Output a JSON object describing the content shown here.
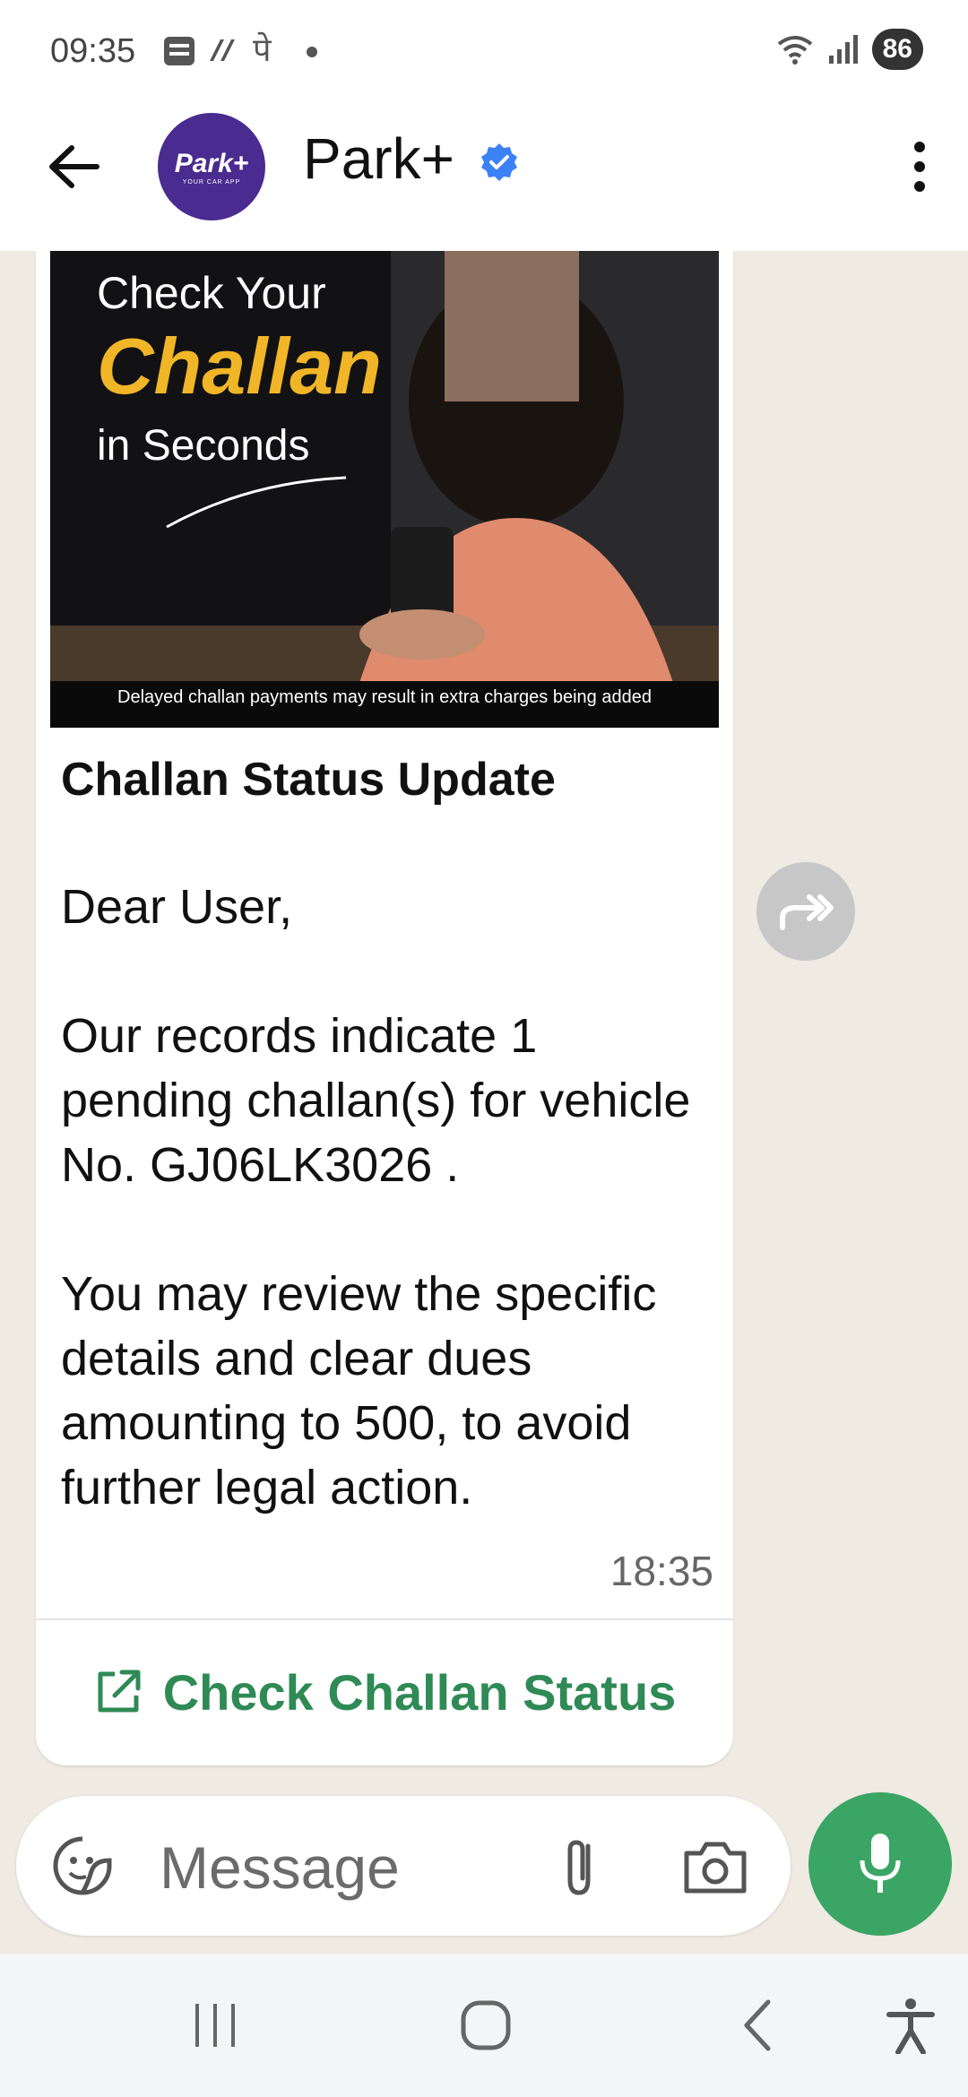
{
  "status_bar": {
    "time": "09:35",
    "battery": "86",
    "notifications": [
      "app-icon",
      "app-icon",
      "pe-icon",
      "dot-icon"
    ],
    "notif_pe": "पे"
  },
  "header": {
    "contact_name": "Park+",
    "avatar_main": "Park+",
    "avatar_sub": "YOUR CAR APP",
    "verified_color": "#3b82f6",
    "brand_color": "#4a2b8f"
  },
  "message": {
    "banner": {
      "line1": "Check Your",
      "line2": "Challan",
      "line3": "in Seconds",
      "disclaimer": "Delayed challan payments may result in extra charges being added"
    },
    "title": "Challan Status Update",
    "greeting": "Dear User,",
    "para1": "Our records indicate 1 pending challan(s) for vehicle No. GJ06LK3026 .",
    "para2": "You may review the specific details and clear dues amounting to 500, to avoid further legal action.",
    "time": "18:35",
    "cta_label": "Check Challan Status",
    "cta_color": "#2f8a55"
  },
  "composer": {
    "placeholder": "Message",
    "mic_color": "#3aa564"
  },
  "nav_bar": {
    "items": [
      "recent-apps-icon",
      "home-icon",
      "back-icon",
      "accessibility-icon"
    ]
  }
}
